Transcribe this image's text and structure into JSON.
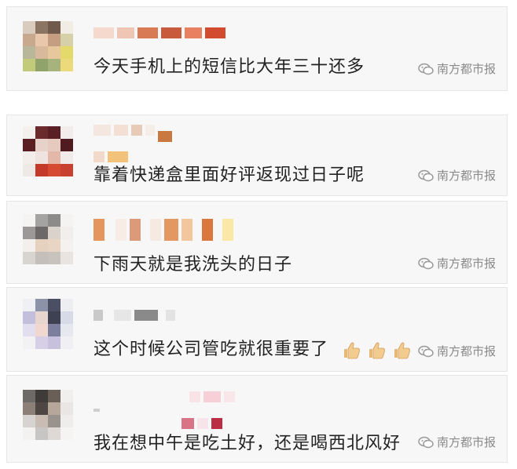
{
  "watermark": {
    "label": "南方都市报"
  },
  "comments": [
    {
      "text": "今天手机上的短信比大年三十还多"
    },
    {
      "text": "靠着快递盒里面好评返现过日子呢"
    },
    {
      "text": "下雨天就是我洗头的日子"
    },
    {
      "text": "这个时候公司管吃就很重要了",
      "emoji": "thumbs-up x3"
    },
    {
      "text": "我在想中午是吃土好，还是喝西北风好"
    }
  ],
  "colors": {
    "card_background": "#f7f7f7",
    "card_border": "#e6e6e6",
    "text": "#222222",
    "watermark": "#8a8a8a"
  }
}
